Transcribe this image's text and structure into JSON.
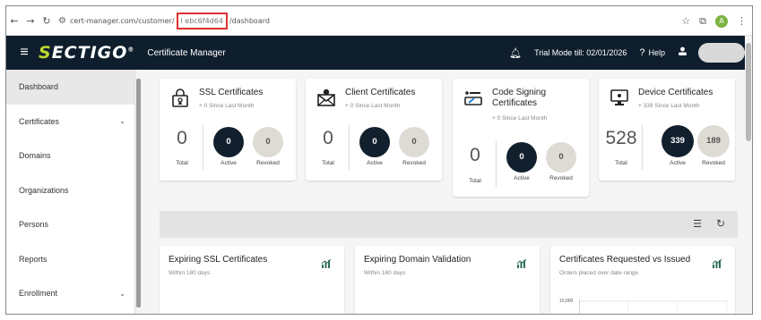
{
  "browser": {
    "url_prefix": "cert-manager.com/customer/",
    "url_redacted": "i      ebc6f4d64",
    "url_suffix": "/dashboard",
    "profile_letter": "A"
  },
  "header": {
    "brand": "ECTIGO",
    "brand_first": "S",
    "app_title": "Certificate Manager",
    "trial": "Trial Mode till: 02/01/2026",
    "help": "Help"
  },
  "sidebar": {
    "items": [
      {
        "label": "Dashboard"
      },
      {
        "label": "Certificates"
      },
      {
        "label": "Domains"
      },
      {
        "label": "Organizations"
      },
      {
        "label": "Persons"
      },
      {
        "label": "Reports"
      },
      {
        "label": "Enrollment"
      }
    ]
  },
  "cards": [
    {
      "title": "SSL Certificates",
      "sub": "+ 0 Since Last Month",
      "total": "0",
      "total_label": "Total",
      "active": "0",
      "active_label": "Active",
      "revoked": "0",
      "revoked_label": "Revoked",
      "icon": "ssl-certificate-icon"
    },
    {
      "title": "Client Certificates",
      "sub": "+ 0 Since Last Month",
      "total": "0",
      "total_label": "Total",
      "active": "0",
      "active_label": "Active",
      "revoked": "0",
      "revoked_label": "Revoked",
      "icon": "client-certificate-icon"
    },
    {
      "title": "Code Signing Certificates",
      "sub": "+ 0 Since Last Month",
      "total": "0",
      "total_label": "Total",
      "active": "0",
      "active_label": "Active",
      "revoked": "0",
      "revoked_label": "Revoked",
      "icon": "code-signing-icon"
    },
    {
      "title": "Device Certificates",
      "sub": "+ 339 Since Last Month",
      "total": "528",
      "total_label": "Total",
      "active": "339",
      "active_label": "Active",
      "revoked": "189",
      "revoked_label": "Revoked",
      "icon": "device-certificate-icon"
    }
  ],
  "panels": [
    {
      "title": "Expiring SSL Certificates",
      "sub": "Within 180 days"
    },
    {
      "title": "Expiring Domain Validation",
      "sub": "Within 180 days"
    },
    {
      "title": "Certificates Requested vs Issued",
      "sub": "Orders placed over date range",
      "tick": "10,000"
    }
  ],
  "colors": {
    "header_bg": "#0e1e2d",
    "brand_accent": "#bfd730",
    "active_circle": "#12202e",
    "revoked_circle": "#dedbd5",
    "redaction_box": "#e03030"
  }
}
